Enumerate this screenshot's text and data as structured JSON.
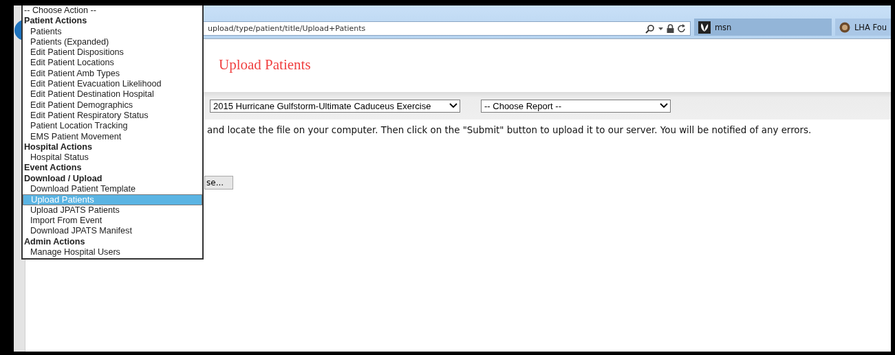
{
  "browser": {
    "address": "upload/type/patient/title/Upload+Patients",
    "tabs": [
      {
        "label": "msn",
        "selected": true
      },
      {
        "label": "LHA Fou",
        "selected": false
      }
    ]
  },
  "page": {
    "title": "Upload Patients",
    "event_select": "2015 Hurricane Gulfstorm-Ultimate Caduceus Exercise",
    "report_select": "-- Choose Report --",
    "instructions": "and locate the file on your computer. Then click on the \"Submit\" button to upload it to our server. You will be notified of any errors.",
    "browse_button": "se..."
  },
  "action_menu": {
    "items": [
      {
        "label": "-- Choose Action --",
        "kind": "placeholder",
        "selected": false
      },
      {
        "label": "Patient Actions",
        "kind": "group",
        "selected": false
      },
      {
        "label": "Patients",
        "kind": "option",
        "selected": false
      },
      {
        "label": "Patients (Expanded)",
        "kind": "option",
        "selected": false
      },
      {
        "label": "Edit Patient Dispositions",
        "kind": "option",
        "selected": false
      },
      {
        "label": "Edit Patient Locations",
        "kind": "option",
        "selected": false
      },
      {
        "label": "Edit Patient Amb Types",
        "kind": "option",
        "selected": false
      },
      {
        "label": "Edit Patient Evacuation Likelihood",
        "kind": "option",
        "selected": false
      },
      {
        "label": "Edit Patient Destination Hospital",
        "kind": "option",
        "selected": false
      },
      {
        "label": "Edit Patient Demographics",
        "kind": "option",
        "selected": false
      },
      {
        "label": "Edit Patient Respiratory Status",
        "kind": "option",
        "selected": false
      },
      {
        "label": "Patient Location Tracking",
        "kind": "option",
        "selected": false
      },
      {
        "label": "EMS Patient Movement",
        "kind": "option",
        "selected": false
      },
      {
        "label": "Hospital Actions",
        "kind": "group",
        "selected": false
      },
      {
        "label": "Hospital Status",
        "kind": "option",
        "selected": false
      },
      {
        "label": "Event Actions",
        "kind": "group",
        "selected": false
      },
      {
        "label": "Download / Upload",
        "kind": "group",
        "selected": false
      },
      {
        "label": "Download Patient Template",
        "kind": "option",
        "selected": false
      },
      {
        "label": "Upload Patients",
        "kind": "option",
        "selected": true
      },
      {
        "label": "Upload JPATS Patients",
        "kind": "option",
        "selected": false
      },
      {
        "label": "Import From Event",
        "kind": "option",
        "selected": false
      },
      {
        "label": "Download JPATS Manifest",
        "kind": "option",
        "selected": false
      },
      {
        "label": "Admin Actions",
        "kind": "group",
        "selected": false
      },
      {
        "label": "Manage Hospital Users",
        "kind": "option",
        "selected": false
      }
    ]
  }
}
